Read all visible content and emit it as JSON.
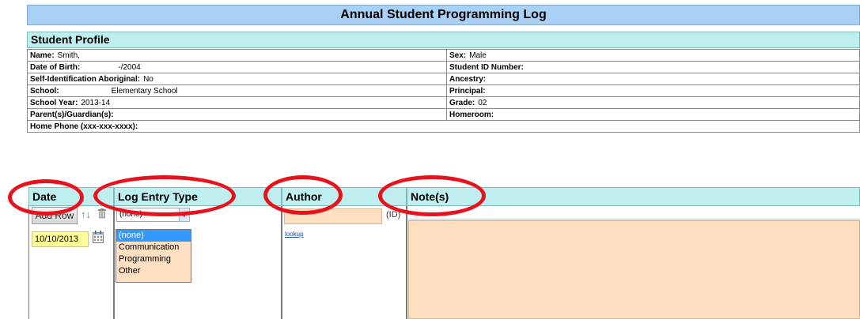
{
  "page": {
    "title": "Annual Student Programming Log"
  },
  "profile": {
    "header": "Student Profile",
    "rows": [
      {
        "left_label": "Name:",
        "left_value": "Smith,",
        "right_label": "Sex:",
        "right_value": "Male"
      },
      {
        "left_label": "Date of Birth:",
        "left_value": "-/2004",
        "right_label": "Student ID Number:",
        "right_value": ""
      },
      {
        "left_label": "Self-Identification Aboriginal:",
        "left_value": "No",
        "right_label": "Ancestry:",
        "right_value": ""
      },
      {
        "left_label": "School:",
        "left_value": "Elementary School",
        "right_label": "Principal:",
        "right_value": ""
      },
      {
        "left_label": "School Year:",
        "left_value": "2013-14",
        "right_label": "Grade:",
        "right_value": "02"
      },
      {
        "left_label": "Parent(s)/Guardian(s):",
        "left_value": "",
        "right_label": "Homeroom:",
        "right_value": ""
      }
    ],
    "home_phone_label": "Home Phone (xxx-xxx-xxxx):",
    "home_phone_value": ""
  },
  "log": {
    "columns": {
      "date": "Date",
      "type": "Log Entry Type",
      "author": "Author",
      "notes": "Note(s)"
    },
    "add_row_label": "Add Row",
    "date_value": "10/10/2013",
    "type_selected": "(none)",
    "type_options": [
      "(none)",
      "Communication",
      "Programming",
      "Other"
    ],
    "author_value": "",
    "author_id_label": "(ID)",
    "lookup_label": "lookup",
    "notes_value": ""
  },
  "colors": {
    "title_bg": "#a9d0f5",
    "section_bg": "#bfeeee",
    "date_input_bg": "#ffff99",
    "field_bg": "#ffdfc0",
    "annotation_red": "#e8121d",
    "selected_option": "#3399ff"
  },
  "icons": {
    "sort": "sort-arrows-icon",
    "delete": "trash-icon",
    "calendar": "calendar-icon",
    "select_arrow": "chevron-down-icon"
  }
}
